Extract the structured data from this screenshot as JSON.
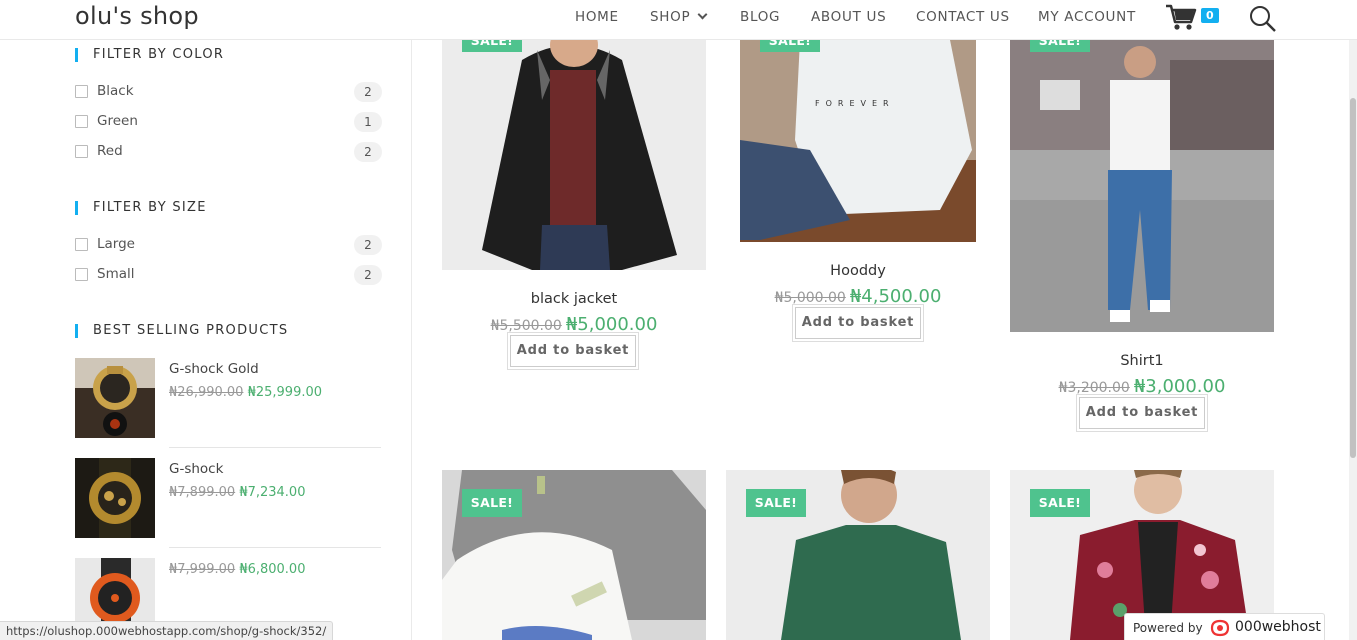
{
  "header": {
    "logo": "olu's shop",
    "nav": [
      "HOME",
      "SHOP",
      "BLOG",
      "ABOUT US",
      "CONTACT US",
      "MY ACCOUNT"
    ],
    "cart_count": "0"
  },
  "sidebar": {
    "color_title": "FILTER BY COLOR",
    "colors": [
      {
        "label": "Black",
        "count": "2"
      },
      {
        "label": "Green",
        "count": "1"
      },
      {
        "label": "Red",
        "count": "2"
      }
    ],
    "size_title": "FILTER BY SIZE",
    "sizes": [
      {
        "label": "Large",
        "count": "2"
      },
      {
        "label": "Small",
        "count": "2"
      }
    ],
    "best_title": "BEST SELLING PRODUCTS",
    "best": [
      {
        "name": "G-shock Gold",
        "old": "₦26,990.00",
        "new": "₦25,999.00"
      },
      {
        "name": "G-shock",
        "old": "₦7,899.00",
        "new": "₦7,234.00"
      },
      {
        "name": "",
        "old": "₦7,999.00",
        "new": "₦6,800.00"
      }
    ]
  },
  "products": [
    {
      "sale": "SALE!",
      "title": "black jacket",
      "old": "₦5,500.00",
      "new": "₦5,000.00",
      "button": "Add to basket"
    },
    {
      "sale": "SALE!",
      "title": "Hooddy",
      "old": "₦5,000.00",
      "new": "₦4,500.00",
      "button": "Add to basket"
    },
    {
      "sale": "SALE!",
      "title": "Shirt1",
      "old": "₦3,200.00",
      "new": "₦3,000.00",
      "button": "Add to basket"
    },
    {
      "sale": "SALE!"
    },
    {
      "sale": "SALE!"
    },
    {
      "sale": "SALE!"
    }
  ],
  "status_url": "https://olushop.000webhostapp.com/shop/g-shock/352/",
  "powered": {
    "label": "Powered by",
    "brand": "000webhost"
  },
  "colors": {
    "accent": "#13aff0",
    "sale": "#4fc38e",
    "price_new": "#4caf70"
  }
}
